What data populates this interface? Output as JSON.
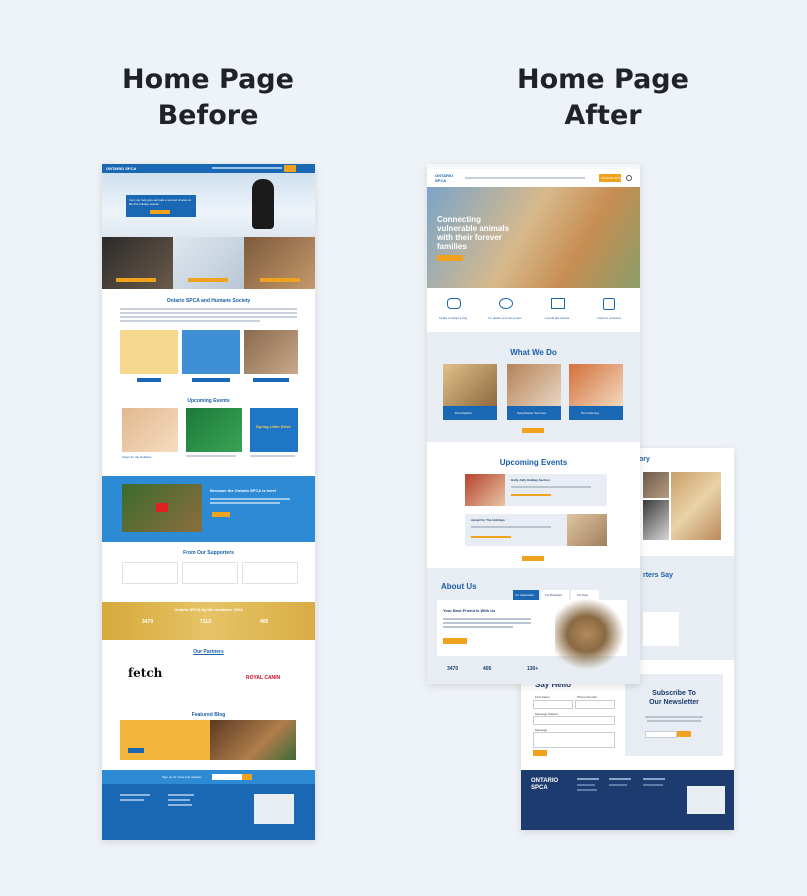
{
  "headings": {
    "before": [
      "Home Page",
      "Before"
    ],
    "after": [
      "Home Page",
      "After"
    ]
  },
  "before": {
    "logo": "ONTARIO SPCA",
    "hero_text": "Can you help give animals a second chance at life this holiday season",
    "intro_title": "Ontario SPCA and Humane Society",
    "upcoming_events": "Upcoming Events",
    "event_tiles": [
      "Adopt for the Holidays",
      "Spring Litter Drive"
    ],
    "video_heading": "Because the Ontario SPCA is here!",
    "supporters_title": "From Our Supporters",
    "numbers_title": "Ontario SPCA by the numbers: 2022",
    "numbers": [
      "3470",
      "7113",
      "405"
    ],
    "partners_title": "Our Partners",
    "partner_logos": [
      "fetch",
      "ROYAL CANIN"
    ],
    "featured_blog": "Featured Blog",
    "signup": "Sign up for news and updates"
  },
  "after": {
    "logo": "ONTARIO SPCA",
    "nav_cta": "DONATE NOW",
    "hero_title": "Connecting vulnerable animals with their forever families",
    "icon_labels": [
      "I'd like to adopt a dog",
      "I'm aware of a cat person",
      "I would like donate",
      "I want to volunteer"
    ],
    "what_we_do": "What We Do",
    "services": [
      "Pet Adoption",
      "Spay/Neuter Services",
      "Pet Fostering"
    ],
    "upcoming_events": "Upcoming Events",
    "events": [
      "Holly Jolly Holiday Auction",
      "Adopt For The Holidays"
    ],
    "about_title": "About Us",
    "about_tabs": [
      "Our Organization",
      "Our Philosophy",
      "Our Team"
    ],
    "about_heading": "Your Best Friend Is With Us",
    "stats": [
      "3470",
      "405",
      "130+"
    ],
    "story_title": "ory",
    "supporters_title": "rters Say",
    "say_hello": "Say Hello",
    "form_labels": [
      "First Name",
      "Phone Number",
      "Message Subject",
      "Message"
    ],
    "newsletter_title": [
      "Subscribe To",
      "Our Newsletter"
    ],
    "footer_logo": "ONTARIO SPCA"
  },
  "colors": {
    "blue": "#1a67b3",
    "orange": "#f0a21d",
    "navy": "#1d3b6e",
    "gold": "#e0b23c",
    "bg": "#eef3f7"
  }
}
